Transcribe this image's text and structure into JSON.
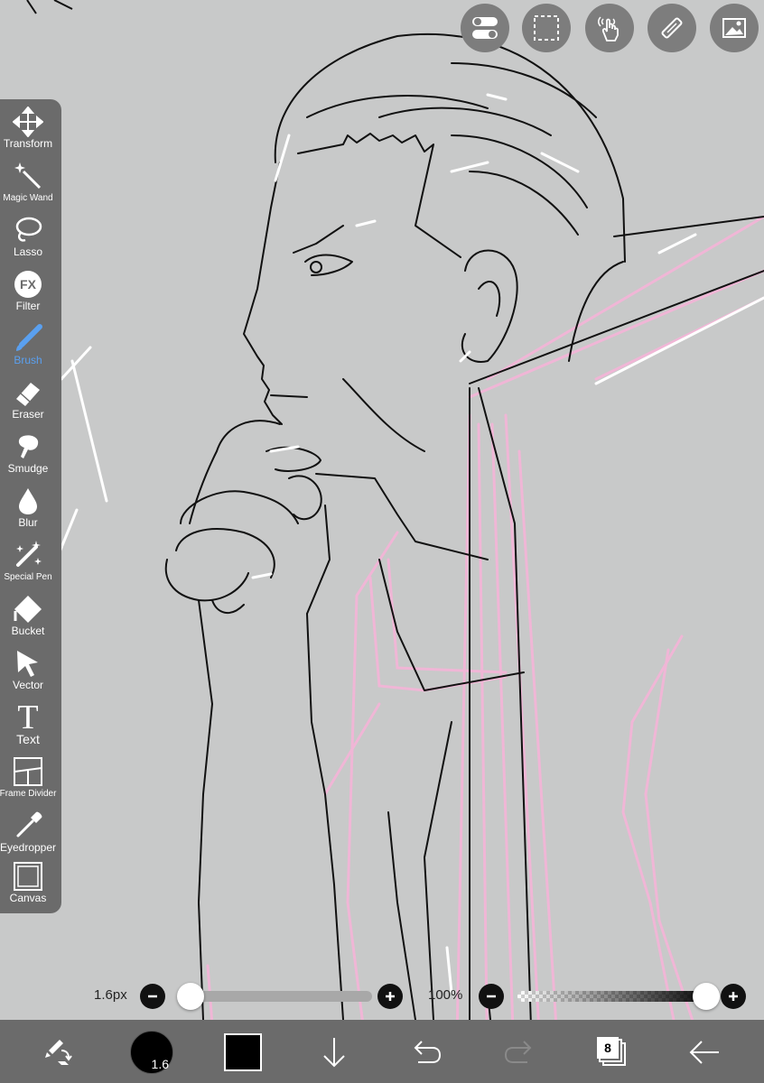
{
  "toolbar": {
    "tools": [
      {
        "label": "Transform",
        "icon": "move-arrows-icon"
      },
      {
        "label": "Magic Wand",
        "icon": "magic-wand-icon"
      },
      {
        "label": "Lasso",
        "icon": "lasso-icon"
      },
      {
        "label": "Filter",
        "icon": "fx-icon"
      },
      {
        "label": "Brush",
        "icon": "brush-icon"
      },
      {
        "label": "Eraser",
        "icon": "eraser-icon"
      },
      {
        "label": "Smudge",
        "icon": "smudge-icon"
      },
      {
        "label": "Blur",
        "icon": "droplet-icon"
      },
      {
        "label": "Special Pen",
        "icon": "sparkle-pen-icon"
      },
      {
        "label": "Bucket",
        "icon": "bucket-icon"
      },
      {
        "label": "Vector",
        "icon": "cursor-arrow-icon"
      },
      {
        "label": "Text",
        "icon": "text-t-icon"
      },
      {
        "label": "Frame Divider",
        "icon": "frame-divider-icon"
      },
      {
        "label": "Eyedropper",
        "icon": "eyedropper-icon"
      },
      {
        "label": "Canvas",
        "icon": "canvas-square-icon"
      }
    ],
    "active_tool": "Brush",
    "filter_glyph": "FX",
    "text_glyph": "T"
  },
  "top_buttons": [
    "toggle-icon",
    "selection-icon",
    "gesture-hand-icon",
    "ruler-icon",
    "image-icon"
  ],
  "brush_size": {
    "value_label": "1.6px",
    "fraction": 0.0
  },
  "opacity": {
    "value_label": "100%",
    "fraction": 1.0
  },
  "bottom_bar": {
    "brush_size_badge": "1.6",
    "layer_count": "8",
    "current_color": "#000000"
  },
  "colors": {
    "canvas_bg": "#c8c9c9",
    "panel": "#6b6b6b",
    "active_tool": "#5aa0f0",
    "sketch_pink": "#f0b6d6"
  }
}
